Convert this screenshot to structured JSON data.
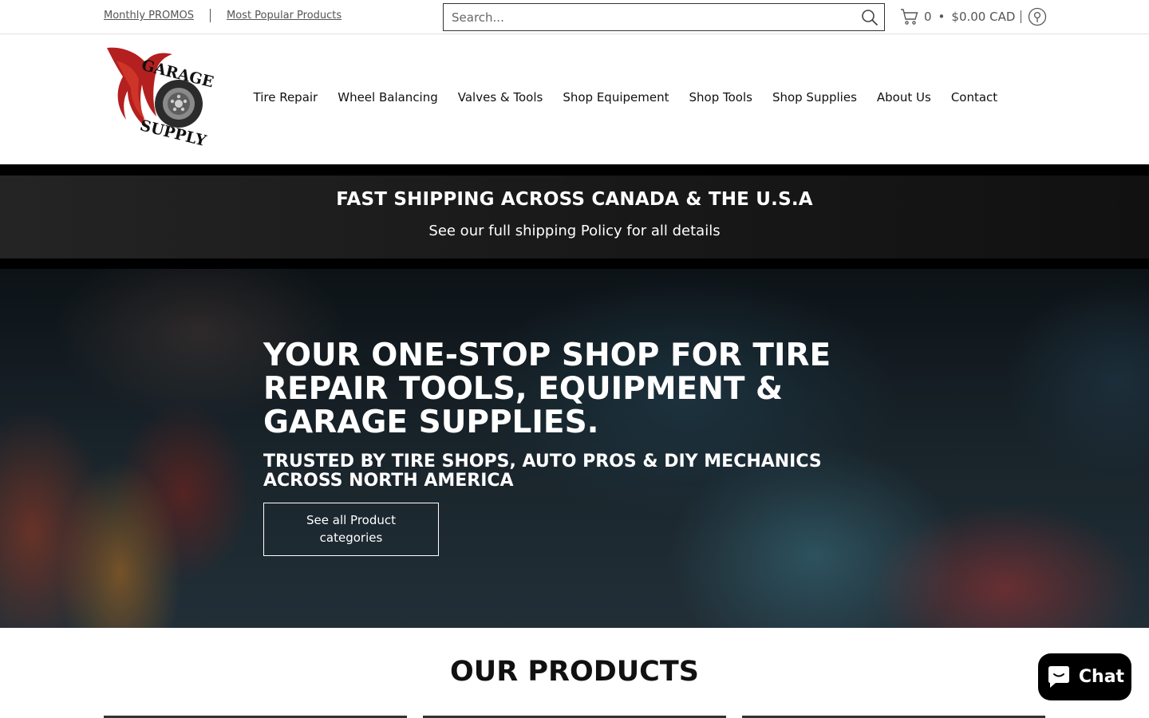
{
  "utility": {
    "links": [
      "Monthly PROMOS",
      "Most Popular Products"
    ],
    "search_placeholder": "Search...",
    "cart_count": "0",
    "cart_total": "$0.00 CAD"
  },
  "logo": {
    "line1": "GARAGE",
    "line2": "SUPPLY"
  },
  "nav": {
    "items": [
      "Tire Repair",
      "Wheel Balancing",
      "Valves & Tools",
      "Shop Equipement",
      "Shop Tools",
      "Shop Supplies",
      "About Us",
      "Contact"
    ]
  },
  "shipping": {
    "title": "FAST SHIPPING ACROSS CANADA & THE U.S.A",
    "subtitle": "See our full shipping Policy for all details"
  },
  "hero": {
    "title": "YOUR ONE-STOP SHOP FOR TIRE REPAIR TOOLS, EQUIPMENT & GARAGE SUPPLIES.",
    "subtitle": "TRUSTED BY TIRE SHOPS, AUTO PROS & DIY MECHANICS ACROSS NORTH AMERICA",
    "button_label": "See all Product categories"
  },
  "products": {
    "title": "OUR PRODUCTS"
  },
  "chat": {
    "label": "Chat"
  }
}
